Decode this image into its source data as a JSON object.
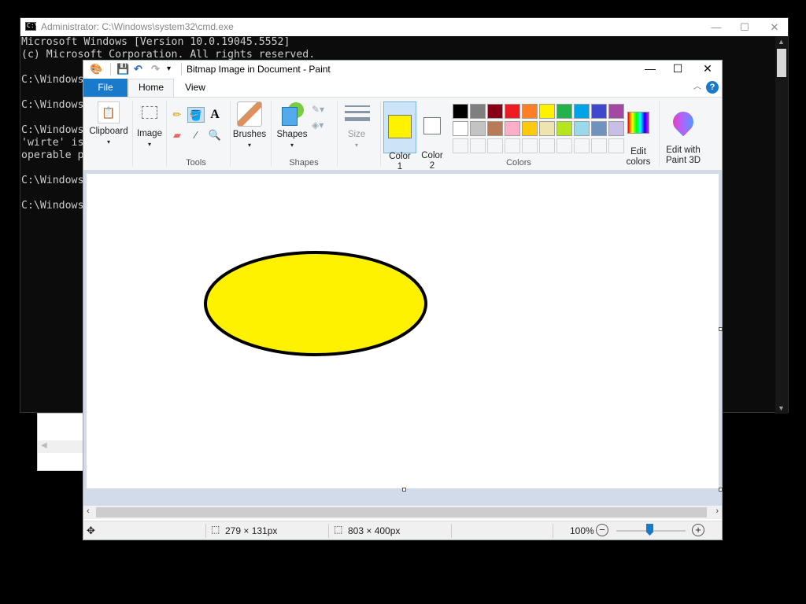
{
  "cmd": {
    "title": "Administrator: C:\\Windows\\system32\\cmd.exe",
    "lines": [
      "Microsoft Windows [Version 10.0.19045.5552]",
      "(c) Microsoft Corporation. All rights reserved.",
      "",
      "C:\\Windows",
      "",
      "C:\\Windows",
      "",
      "C:\\Windows",
      "'wirte' is",
      "operable p",
      "",
      "C:\\Windows",
      "",
      "C:\\Windows"
    ]
  },
  "paint": {
    "title": "Bitmap Image in Document - Paint",
    "tabs": {
      "file": "File",
      "home": "Home",
      "view": "View"
    },
    "help": "?",
    "groups": {
      "clipboard": "Clipboard",
      "image": "Image",
      "tools": "Tools",
      "brushes": "Brushes",
      "shapes_btn": "Shapes",
      "shapes": "Shapes",
      "size": "Size",
      "color1": "Color\n1",
      "color2": "Color\n2",
      "colors": "Colors",
      "edit_colors": "Edit\ncolors",
      "edit_paint3d": "Edit with\nPaint 3D"
    },
    "color1_value": "#fff200",
    "color2_value": "#ffffff",
    "palette": [
      "#000000",
      "#7f7f7f",
      "#880015",
      "#ed1c24",
      "#ff7f27",
      "#fff200",
      "#22b14c",
      "#00a2e8",
      "#3f48cc",
      "#a349a4",
      "#ffffff",
      "#c3c3c3",
      "#b97a57",
      "#ffaec9",
      "#ffc90e",
      "#efe4b0",
      "#b5e61d",
      "#99d9ea",
      "#7092be",
      "#c8bfe7",
      "",
      "",
      "",
      "",
      "",
      "",
      "",
      "",
      "",
      ""
    ],
    "status": {
      "selection_size": "279 × 131px",
      "canvas_size": "803 × 400px",
      "zoom": "100%"
    },
    "ellipse": {
      "fill": "#fff200",
      "stroke": "#000000"
    }
  }
}
